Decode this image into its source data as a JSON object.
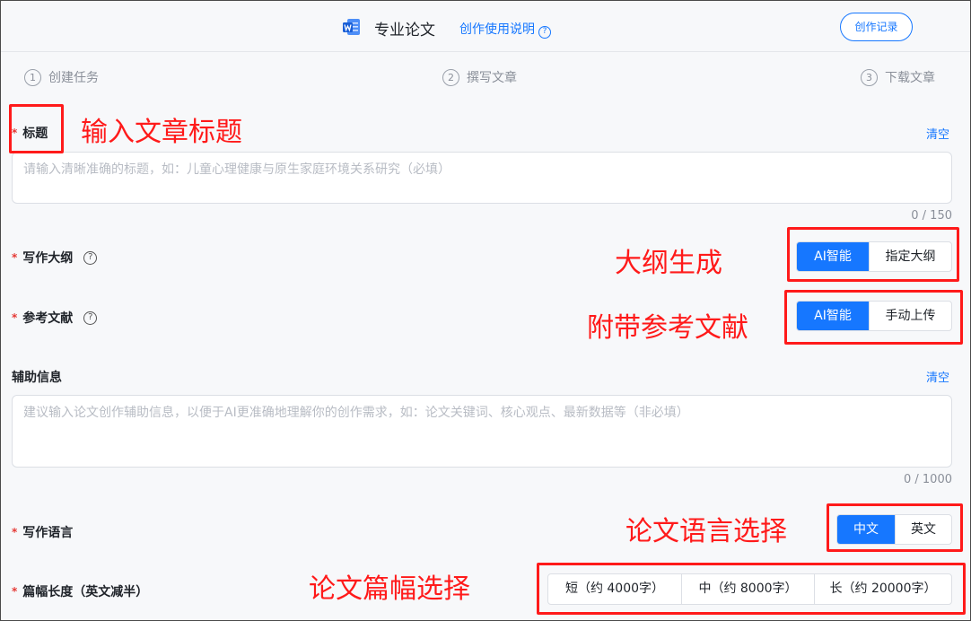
{
  "header": {
    "title": "专业论文",
    "help_link": "创作使用说明",
    "record_button": "创作记录"
  },
  "steps": [
    {
      "num": "1",
      "label": "创建任务"
    },
    {
      "num": "2",
      "label": "撰写文章"
    },
    {
      "num": "3",
      "label": "下载文章"
    }
  ],
  "form": {
    "required_mark": "*",
    "title_label": "标题",
    "title_clear": "清空",
    "title_placeholder": "请输入清晰准确的标题，如：儿童心理健康与原生家庭环境关系研究（必填）",
    "title_counter": "0 / 150",
    "outline_label": "写作大纲",
    "outline_options": [
      "AI智能",
      "指定大纲"
    ],
    "reference_label": "参考文献",
    "reference_options": [
      "AI智能",
      "手动上传"
    ],
    "aux_label": "辅助信息",
    "aux_clear": "清空",
    "aux_placeholder": "建议输入论文创作辅助信息，以便于AI更准确地理解你的创作需求，如：论文关键词、核心观点、最新数据等（非必填）",
    "aux_counter": "0 / 1000",
    "language_label": "写作语言",
    "language_options": [
      "中文",
      "英文"
    ],
    "length_label": "篇幅长度（英文减半）",
    "length_options": [
      "短（约 4000字）",
      "中（约 8000字）",
      "长（约 20000字）"
    ]
  },
  "annotations": {
    "title": "输入文章标题",
    "outline": "大纲生成",
    "reference": "附带参考文献",
    "language": "论文语言选择",
    "length": "论文篇幅选择"
  },
  "colors": {
    "accent": "#1677ff",
    "annotation": "#ff1a1a",
    "required": "#e53935"
  }
}
